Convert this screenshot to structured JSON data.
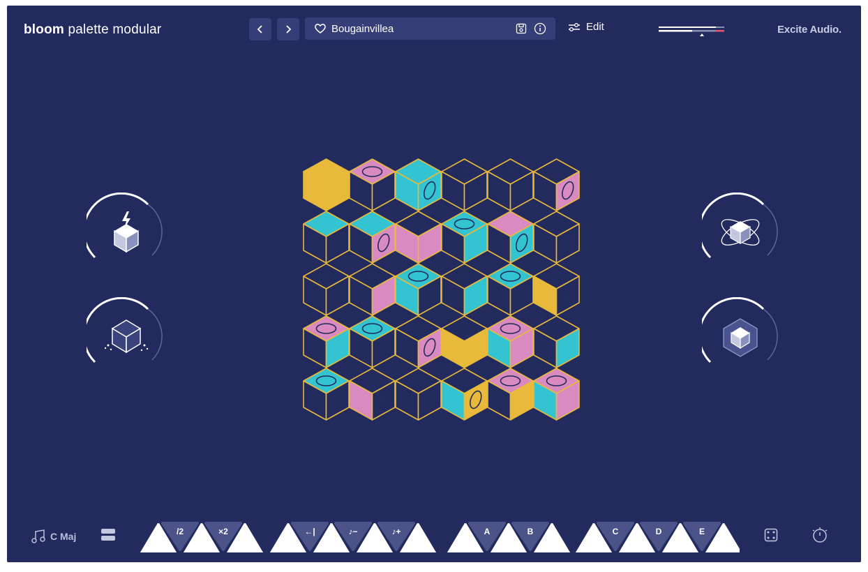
{
  "header": {
    "brand_bold": "bloom",
    "brand_rest": "palette modular",
    "preset_name": "Bougainvillea",
    "edit_label": "Edit",
    "company": "Excite Audio."
  },
  "footer": {
    "key_label": "C Maj",
    "rate_buttons": [
      "/2",
      "×2"
    ],
    "note_buttons": [
      "←|",
      "♪−",
      "♪+"
    ],
    "pattern_buttons": [
      "A",
      "B",
      "C",
      "D",
      "E"
    ]
  },
  "knobs": {
    "left": [
      "lightning-cube",
      "shatter-cube"
    ],
    "right": [
      "orbit-cube",
      "layered-cube"
    ]
  },
  "grid": {
    "rows": 5,
    "cols": 6,
    "colors": {
      "yellow": "#e8b93a",
      "pink": "#d98ac0",
      "cyan": "#34c3d1",
      "outline": "#e8b93a",
      "bg": "#222a5e"
    },
    "cells": [
      [
        "yyy",
        "pnn",
        "ccc",
        "nnn",
        "nnn",
        "nnp"
      ],
      [
        "cnn",
        "cnp",
        "npp",
        "cnc",
        "pnc",
        "nnn"
      ],
      [
        "nnn",
        "nnp",
        "ccn",
        "nnc",
        "cnn",
        "nyn"
      ],
      [
        "pnc",
        "cnn",
        "nnp",
        "nyy",
        "pcp",
        "nnc"
      ],
      [
        "cnn",
        "npn",
        "nnn",
        "ncy",
        "pny",
        "pcp"
      ]
    ],
    "holes": [
      [
        "none",
        "top",
        "right",
        "top",
        "top",
        "right"
      ],
      [
        "none",
        "right",
        "none",
        "top",
        "right",
        "top"
      ],
      [
        "top",
        "top",
        "top",
        "top",
        "top",
        "right"
      ],
      [
        "top",
        "top",
        "right",
        "top",
        "top",
        "top"
      ],
      [
        "top",
        "right",
        "none",
        "right",
        "top",
        "top"
      ]
    ]
  }
}
